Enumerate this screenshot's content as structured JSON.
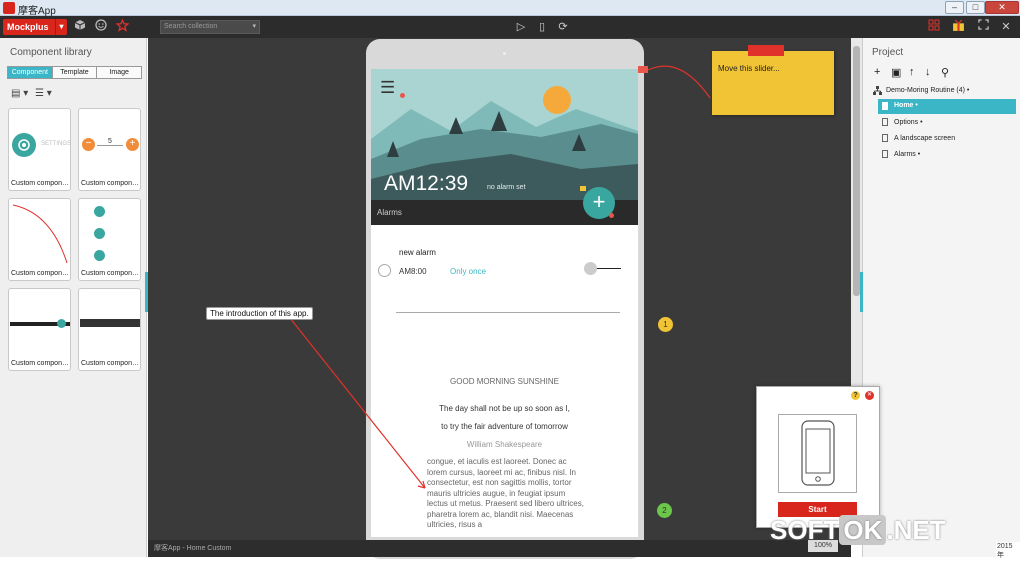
{
  "window": {
    "title": "摩客App",
    "minimize": "–",
    "maximize": "□",
    "close": "✕"
  },
  "toolbar": {
    "brand": "Mockplus",
    "brand_caret": "▾",
    "search_placeholder": "Search collection",
    "search_caret": "▾",
    "play": "▷",
    "device": "▯",
    "sync": "⟳",
    "close_panel": "✕"
  },
  "left_panel": {
    "title": "Component library",
    "tabs": [
      {
        "label": "Component",
        "active": true
      },
      {
        "label": "Template",
        "active": false
      },
      {
        "label": "Image",
        "active": false
      }
    ],
    "view_icons": [
      "▤ ▾",
      "☰ ▾"
    ],
    "cards": [
      {
        "label": "Custom compon…",
        "preview_text": "SETTINGS"
      },
      {
        "label": "Custom compon…",
        "preview_text": "5"
      },
      {
        "label": "Custom compon…",
        "preview_text": ""
      },
      {
        "label": "Custom compon…",
        "preview_text": ""
      },
      {
        "label": "Custom compon…",
        "preview_text": ""
      },
      {
        "label": "Custom compon…",
        "preview_text": ""
      }
    ],
    "stepper": {
      "minus": "−",
      "plus": "+"
    }
  },
  "phone": {
    "hamburger": "☰",
    "time": "AM12:39",
    "no_alarm": "no alarm set",
    "fab": "+",
    "alarms_bar": "Alarms",
    "new_alarm": "new alarm",
    "alarm_time": "AM8:00",
    "repeat": "Only once",
    "good_morning": "GOOD MORNING SUNSHINE",
    "quote_line1": "The day shall not be up so soon as I,",
    "quote_line2": "to try the fair adventure of tomorrow",
    "author": "William Shakespeare",
    "lorem": "congue, et iaculis est laoreet. Donec ac lorem cursus, laoreet mi ac, finibus nisl. In consectetur, est non sagittis mollis, tortor mauris ultricies augue, in feugiat ipsum lectus ut metus. Praesent sed libero ultrices, pharetra lorem ac, blandit nisi. Maecenas ultricies, risus a"
  },
  "annotations": {
    "sticky_note": "Move this slider...",
    "intro_label": "The introduction of this app.",
    "badge_1": "1",
    "badge_2": "2"
  },
  "right_panel": {
    "title": "Project",
    "tools": [
      "+",
      "▣",
      "↑",
      "↓",
      "⚲"
    ],
    "tree": [
      {
        "label": "Demo-Moring Routine (4)",
        "selected": false
      },
      {
        "label": "Home",
        "selected": true
      },
      {
        "label": "Options",
        "selected": false
      },
      {
        "label": "A landscape screen",
        "selected": false
      },
      {
        "label": "Alarms",
        "selected": false
      }
    ]
  },
  "popup": {
    "help": "?",
    "close": "✕",
    "start": "Start"
  },
  "status": {
    "path": "摩客App - Home Custom",
    "zoom": "100%"
  },
  "watermark": {
    "part1": "SOFT",
    "part2": "OK",
    "part3": ".NET"
  },
  "year": "2015年",
  "colors": {
    "accent": "#3ab6c6",
    "brand": "#d9261c",
    "sticky": "#f0c435",
    "fab": "#3aa6a0"
  }
}
